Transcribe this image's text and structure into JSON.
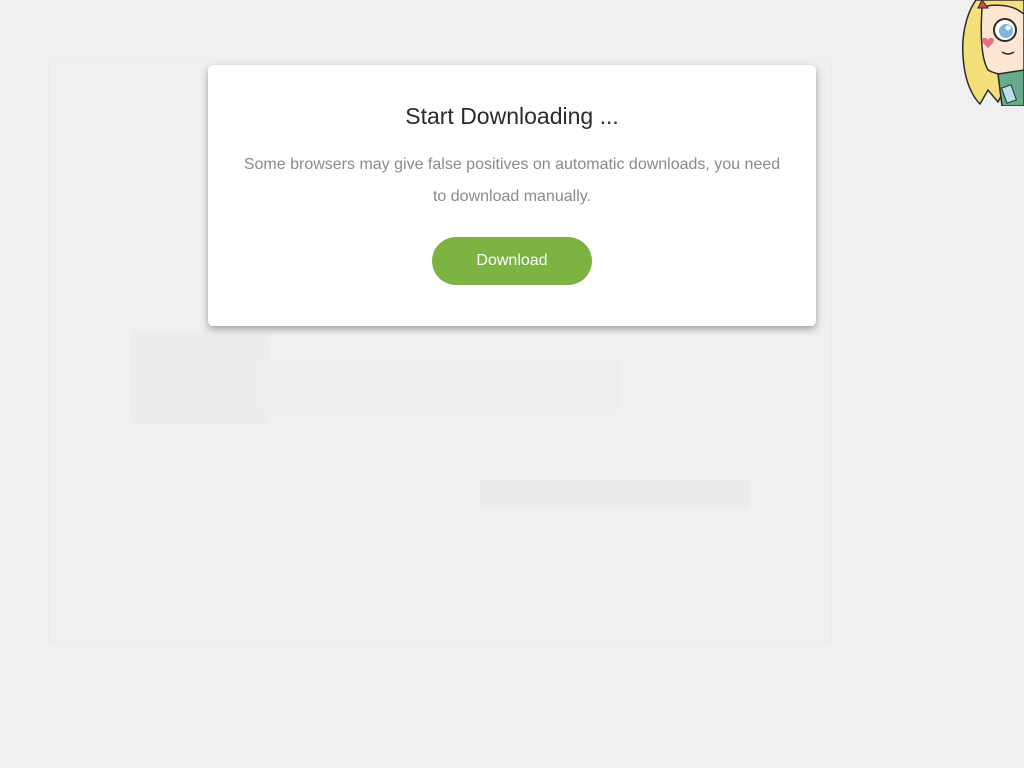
{
  "modal": {
    "title": "Start Downloading ...",
    "message": "Some browsers may give false positives on automatic downloads, you need to download manually.",
    "download_label": "Download"
  },
  "colors": {
    "accent": "#7cb342",
    "background": "#f0f0f0",
    "modal_bg": "#ffffff"
  },
  "icons": {
    "mascot": "cartoon-character-icon"
  }
}
